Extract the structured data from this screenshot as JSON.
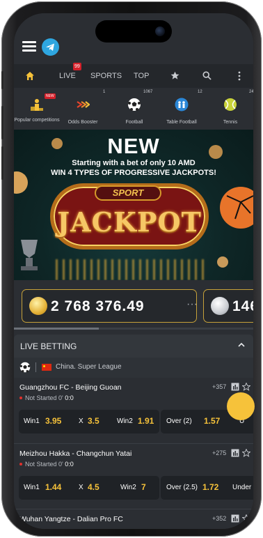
{
  "nav": {
    "live_label": "LIVE",
    "live_badge": "99",
    "sports_label": "SPORTS",
    "top_label": "TOP"
  },
  "categories": [
    {
      "label": "Popular competitions",
      "count": "",
      "tag": "NEW",
      "icon": "trophy-podium-icon"
    },
    {
      "label": "Odds Booster",
      "count": "1",
      "icon": "odds-booster-icon"
    },
    {
      "label": "Football",
      "count": "1067",
      "icon": "football-icon"
    },
    {
      "label": "Table Football",
      "count": "12",
      "icon": "table-football-icon"
    },
    {
      "label": "Tennis",
      "count": "24",
      "icon": "tennis-ball-icon"
    }
  ],
  "banner": {
    "headline": "NEW",
    "line1": "Starting with a bet of only 10 AMD",
    "line2": "WIN 4 TYPES OF PROGRESSIVE JACKPOTS!",
    "sport": "SPORT",
    "jackpot": "JACKPOT"
  },
  "jackpots": [
    {
      "amount": "2 768 376.49",
      "menu": "···",
      "coin": "gold"
    },
    {
      "amount": "146",
      "coin": "silver"
    }
  ],
  "live": {
    "title": "LIVE BETTING",
    "league": "China. Super League",
    "matches": [
      {
        "teams": "Guangzhou FC - Beijing Guoan",
        "markets": "+357",
        "status": "Not Started",
        "minute": "0'",
        "score": "0:0",
        "odds": [
          {
            "label": "Win1",
            "value": "3.95"
          },
          {
            "label": "X",
            "value": "3.5"
          },
          {
            "label": "Win2",
            "value": "1.91"
          },
          {
            "label": "Over (2)",
            "value": "1.57"
          },
          {
            "label": "U",
            "value": ""
          }
        ]
      },
      {
        "teams": "Meizhou Hakka - Changchun Yatai",
        "markets": "+275",
        "status": "Not Started",
        "minute": "0'",
        "score": "0:0",
        "odds": [
          {
            "label": "Win1",
            "value": "1.44"
          },
          {
            "label": "X",
            "value": "4.5"
          },
          {
            "label": "Win2",
            "value": "7"
          },
          {
            "label": "Over (2.5)",
            "value": "1.72"
          },
          {
            "label": "Under (",
            "value": ""
          }
        ]
      },
      {
        "teams": "Wuhan Yangtze - Dalian Pro FC",
        "markets": "+352"
      }
    ]
  },
  "colors": {
    "accent": "#f6c23a",
    "live_red": "#d4202a",
    "bg": "#2b2e33",
    "telegram": "#2ea6e0"
  }
}
